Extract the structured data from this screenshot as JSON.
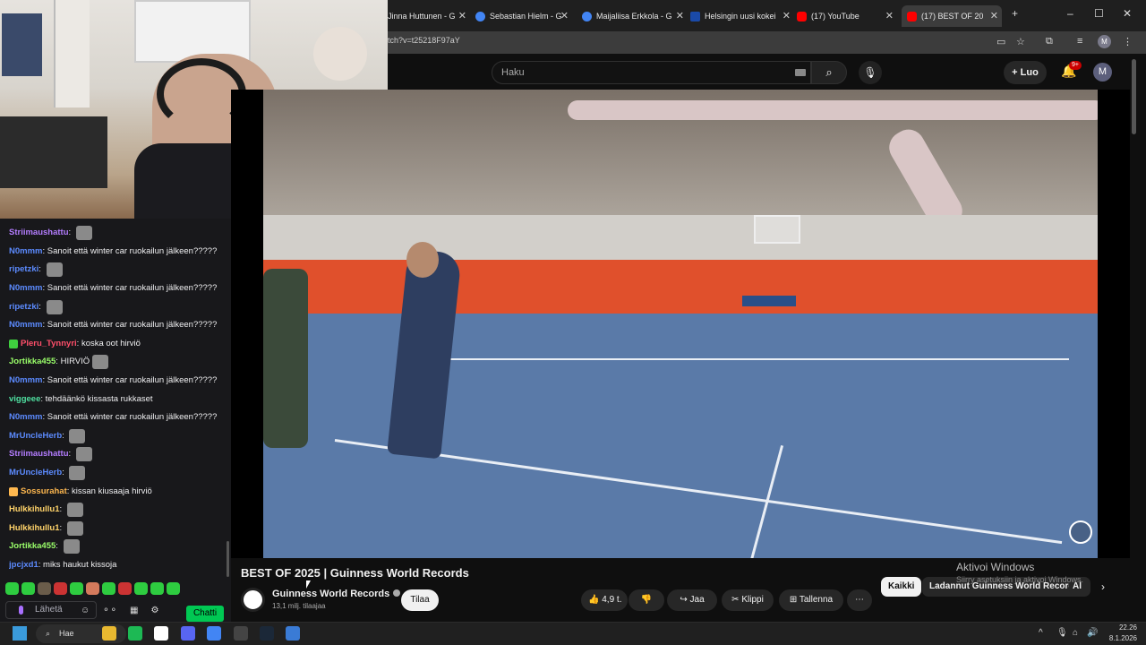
{
  "webcam": {
    "label": "Streamer webcam"
  },
  "chat": {
    "messages": [
      {
        "user": "Striimaushattu",
        "color": "#b47dff",
        "text": "",
        "emote": true,
        "badge": ""
      },
      {
        "user": "N0mmm",
        "color": "#5c8bff",
        "text": "Sanoit että winter car ruokailun jälkeen?????",
        "emote": false,
        "badge": ""
      },
      {
        "user": "ripetzki",
        "color": "#5c8bff",
        "text": "",
        "emote": true,
        "badge": ""
      },
      {
        "user": "N0mmm",
        "color": "#5c8bff",
        "text": "Sanoit että winter car ruokailun jälkeen?????",
        "emote": false,
        "badge": ""
      },
      {
        "user": "ripetzki",
        "color": "#5c8bff",
        "text": "",
        "emote": true,
        "badge": ""
      },
      {
        "user": "N0mmm",
        "color": "#5c8bff",
        "text": "Sanoit että winter car ruokailun jälkeen?????",
        "emote": false,
        "badge": ""
      },
      {
        "user": "Pleru_Tynnyri",
        "color": "#ff4f6a",
        "text": "koska oot hirviö",
        "emote": false,
        "badge": "#3fcf3f"
      },
      {
        "user": "Jortikka455",
        "color": "#9aff6a",
        "text": "HIRVIÖ",
        "emote": true,
        "badge": ""
      },
      {
        "user": "N0mmm",
        "color": "#5c8bff",
        "text": "Sanoit että winter car ruokailun jälkeen?????",
        "emote": false,
        "badge": ""
      },
      {
        "user": "viggeee",
        "color": "#4fdfa0",
        "text": "tehdäänkö kissasta rukkaset",
        "emote": false,
        "badge": ""
      },
      {
        "user": "N0mmm",
        "color": "#5c8bff",
        "text": "Sanoit että winter car ruokailun jälkeen?????",
        "emote": false,
        "badge": ""
      },
      {
        "user": "MrUncleHerb",
        "color": "#5c8bff",
        "text": "",
        "emote": true,
        "badge": ""
      },
      {
        "user": "Striimaushattu",
        "color": "#b47dff",
        "text": "",
        "emote": true,
        "badge": ""
      },
      {
        "user": "MrUncleHerb",
        "color": "#5c8bff",
        "text": "",
        "emote": true,
        "badge": ""
      },
      {
        "user": "Sossurahat",
        "color": "#ffb84f",
        "text": "kissan kiusaaja hirviö",
        "emote": false,
        "badge": "#ffb84f"
      },
      {
        "user": "Hulkkihullu1",
        "color": "#ffd36a",
        "text": "",
        "emote": true,
        "badge": ""
      },
      {
        "user": "Hulkkihullu1",
        "color": "#ffd36a",
        "text": "",
        "emote": true,
        "badge": ""
      },
      {
        "user": "Jortikka455",
        "color": "#9aff6a",
        "text": "",
        "emote": true,
        "badge": ""
      },
      {
        "user": "jpcjxd1",
        "color": "#5c8bff",
        "text": "miks haukut kissoja",
        "emote": false,
        "badge": ""
      }
    ],
    "input_placeholder": "Lähetä",
    "send_button": "Chatti",
    "emote_colors": [
      "#2ecc40",
      "#2ecc40",
      "#6a5c4a",
      "#cc3333",
      "#2ecc40",
      "#d47a5c",
      "#2ecc40",
      "#cc3333",
      "#2ecc40",
      "#2ecc40",
      "#2ecc40"
    ]
  },
  "browser": {
    "tabs": [
      {
        "title": "Jinna Huttunen - G",
        "fav": "#4285f4"
      },
      {
        "title": "Sebastian Hielm - G",
        "fav": "#4285f4"
      },
      {
        "title": "Maijaliisa Erkkola - G",
        "fav": "#4285f4"
      },
      {
        "title": "Helsingin uusi kokei",
        "fav": "#1a4aa8"
      },
      {
        "title": "(17) YouTube",
        "fav": "#ff0000"
      },
      {
        "title": "(17) BEST OF 20",
        "fav": "#ff0000"
      }
    ],
    "new_tab": "+",
    "url": "tch?v=t25218F97aY",
    "profile_initial": "M",
    "win_min": "–",
    "win_max": "☐",
    "win_close": "✕"
  },
  "youtube": {
    "search_placeholder": "Haku",
    "create_label": "Luo",
    "notif_count": "9+",
    "avatar_initial": "M",
    "video_title": "BEST OF 2025 | Guinness World Records",
    "channel_name": "Guinness World Records",
    "subscribers": "13,1 milj. tilaajaa",
    "subscribe_label": "Tilaa",
    "like_count": "4,9 t.",
    "share_label": "Jaa",
    "clip_label": "Klippi",
    "save_label": "Tallenna",
    "chips": [
      "Kaikki",
      "Ladannut Guinness World Records",
      "Al"
    ]
  },
  "overlay": {
    "activate_title": "Aktivoi Windows",
    "activate_sub": "Siirry asetuksiin ja aktivoi Windows."
  },
  "taskbar": {
    "search_label": "Hae",
    "time": "22.26",
    "date": "8.1.2026",
    "apps": [
      "#e8b830",
      "#1db954",
      "#ffffff",
      "#5865f2",
      "#4285f4",
      "#444444",
      "#1b2838",
      "#3a7bd5"
    ]
  }
}
